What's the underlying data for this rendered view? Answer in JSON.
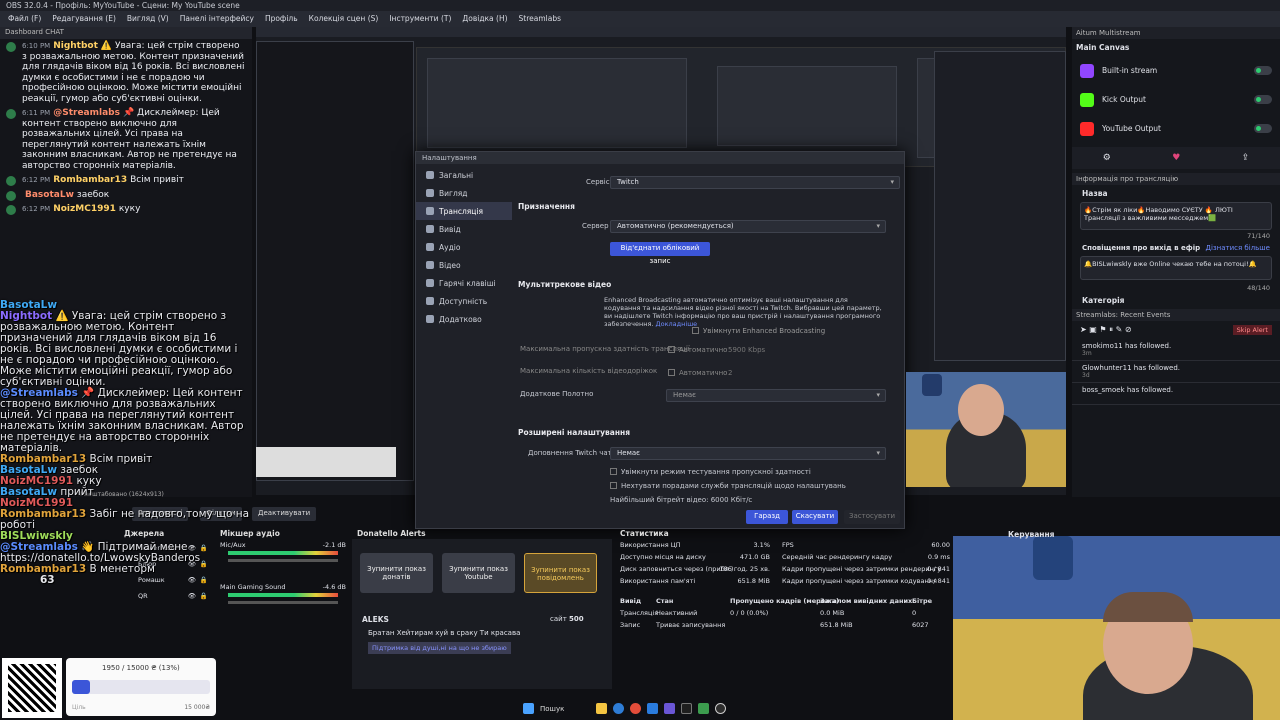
{
  "window": {
    "title": "OBS 32.0.4 - Профіль: MyYouTube - Сцени: My YouTube scene"
  },
  "menu": [
    "Файл (F)",
    "Редагування (E)",
    "Вигляд (V)",
    "Панелі інтерфейсу",
    "Профіль",
    "Колекція сцен (S)",
    "Інструменти (T)",
    "Довідка (H)",
    "Streamlabs"
  ],
  "chat": {
    "header": "Dashboard CHAT",
    "messages": [
      {
        "time": "6:10 PM",
        "user": "Nightbot",
        "text": "⚠️ Увага: цей стрім створено з розважальною метою. Контент призначений для глядачів віком від 16 років. Всі висловлені думки є особистими і не є порадою чи професійною оцінкою. Може містити емоційні реакції, гумор або суб'єктивні оцінки."
      },
      {
        "time": "6:11 PM",
        "user": "@Streamlabs",
        "text": "📌 Дисклеймер: Цей контент створено виключно для розважальних цілей. Усі права на переглянутий контент належать їхнім законним власникам. Автор не претендує на авторство сторонніх матеріалів."
      },
      {
        "time": "6:12 PM",
        "user": "Rombambar13",
        "text": "Всім привіт"
      },
      {
        "time": "",
        "user": "BasotaLw",
        "text": "заебок"
      },
      {
        "time": "6:12 PM",
        "user": "NoizMC1991",
        "text": "куку"
      }
    ]
  },
  "overlay_chat": [
    {
      "user": "BasotaLw",
      "text": ""
    },
    {
      "user": "Nightbot",
      "text": "⚠️ Увага: цей стрім створено з розважальною метою. Контент призначений для глядачів віком від 16 років. Всі висловлені думки є особистими і не є порадою чи професійною оцінкою. Може містити емоційні реакції, гумор або суб'єктивні оцінки."
    },
    {
      "user": "@Streamlabs",
      "text": "📌 Дисклеймер: Цей контент створено виключно для розважальних цілей. Усі права на переглянутий контент належать їхнім законним власникам. Автор не претендує на авторство сторонніх матеріалів."
    },
    {
      "user": "Rombambar13",
      "text": "Всім привіт"
    },
    {
      "user": "BasotaLw",
      "text": "заебок"
    },
    {
      "user": "NoizMC1991",
      "text": "куку"
    },
    {
      "user": "BasotaLw",
      "text": "прийт"
    },
    {
      "user": "NoizMC1991",
      "text": ""
    },
    {
      "user": "Rombambar13",
      "text": "Забіг не надовго,тому що на роботі"
    },
    {
      "user": "BISLwiwskly",
      "text": ""
    },
    {
      "user": "@Streamlabs",
      "text": "👋 Підтримай мене - https://donatello.to/LwowskyBanderos"
    },
    {
      "user": "Rombambar13",
      "text": "В менеторм"
    }
  ],
  "overlay_counter": "63",
  "settings": {
    "title": "Налаштування",
    "sidebar": [
      "Загальні",
      "Вигляд",
      "Трансляція",
      "Вивід",
      "Аудіо",
      "Відео",
      "Гарячі клавіші",
      "Доступність",
      "Додатково"
    ],
    "active_index": 2,
    "service_label": "Сервіс",
    "service_value": "Twitch",
    "purpose_section": "Призначення",
    "server_label": "Сервер",
    "server_value": "Автоматично (рекомендується)",
    "disconnect_button": "Від'єднати обліковий запис",
    "multitrack_section": "Мультитрекове відео",
    "multitrack_desc": "Enhanced Broadcasting автоматично оптимізує ваші налаштування для кодування та надсилання відео різної якості на Twitch. Вибравши цей параметр, ви надішлете Twitch інформацію про ваш пристрій і налаштування програмного забезпечення.",
    "multitrack_more": "Докладніше",
    "enable_enhanced": "Увімкнути Enhanced Broadcasting",
    "max_bandwidth_label": "Максимальна пропускна здатність трансляції",
    "max_video_tracks_label": "Максимальна кількість відеодоріжок",
    "auto_label": "Автоматично",
    "bandwidth_value": "5900 Kbps",
    "tracks_value": "2",
    "extra_canvas_label": "Додаткове Полотно",
    "extra_canvas_value": "Немає",
    "advanced_section": "Розширені налаштування",
    "twitch_chat_label": "Доповнення Twitch чату",
    "twitch_chat_value": "Немає",
    "bw_test": "Увімкнути режим тестування пропускної здатності",
    "ignore_service": "Нехтувати порадами служби трансляцій щодо налаштувань",
    "max_bitrate": "Найбільший бітрейт відео: 6000 Кбіт/с",
    "ok": "Гаразд",
    "cancel": "Скасувати",
    "apply": "Застосувати"
  },
  "multistream": {
    "header": "Aitum Multistream",
    "canvas": "Main Canvas",
    "outputs": [
      {
        "name": "Built-in stream",
        "color": "#9146ff"
      },
      {
        "name": "Kick Output",
        "color": "#53fc18"
      },
      {
        "name": "YouTube Output",
        "color": "#ff2a2a"
      }
    ],
    "info_header": "Інформація про трансляцію",
    "title_label": "Назва",
    "title_value": "🔥Стрім як ліки🔥Наводимо СУЄТУ 🔥 ЛЮТІ Трансляції з важливими месседжем🟩",
    "title_counter": "71/140",
    "notify_label": "Сповіщення про вихід в ефір",
    "notify_more": "Дізнатися більше",
    "notify_value": "🔔BISLwiwskly вже Online чекаю тебе на потоці!🔔",
    "notify_counter": "48/140",
    "category_label": "Категорія",
    "events_header": "Streamlabs: Recent Events",
    "skip_alert": "Skip Alert",
    "events": [
      {
        "user": "smokimo11",
        "text": "has followed.",
        "ago": "3m"
      },
      {
        "user": "Glowhunter11",
        "text": "has followed.",
        "ago": "3d"
      },
      {
        "user": "boss_smoek",
        "text": "has followed.",
        "ago": ""
      }
    ]
  },
  "bottom": {
    "props_button": "Властивості",
    "filters_button": "Фільтри",
    "deactivate_button": "Деактивувати",
    "scale_label": "Масштабовано (1624x913)",
    "sources_header": "Джерела",
    "sources": [
      "Viewer Cour",
      "Блюр",
      "Ромашк",
      "QR"
    ],
    "mixer_header": "Мікшер аудіо",
    "mixer_tracks": [
      {
        "name": "Mic/Aux",
        "db": "-2.1 dB"
      },
      {
        "name": "Main Gaming Sound",
        "db": "-4.6 dB"
      }
    ],
    "donatello_header": "Donatello Alerts",
    "alert_buttons": [
      "Зупинити показ донатів",
      "Зупинити показ Youtube",
      "Зупинити показ повідомлень"
    ],
    "donation": {
      "name": "ALEKS",
      "site": "сайт",
      "amount": "500",
      "message": "Братан Хейтирам хуй в сраку Ти красава",
      "goal_note": "Підтримка від душі,ні на що не збираю"
    },
    "goal": {
      "text": "1950 / 15000 ₴ (13%)",
      "progress": 0.13,
      "end": "15 000₴",
      "start": "Ціль"
    },
    "stats_header": "Статистика",
    "stats": [
      {
        "label": "Використання ЦП",
        "value": "3.1%"
      },
      {
        "label": "Доступно місця на диску",
        "value": "471.0 GB"
      },
      {
        "label": "Диск заповниться через (прибл.)",
        "value": "186 год. 25 хв."
      },
      {
        "label": "Використання пам'яті",
        "value": "651.8 MiB"
      }
    ],
    "stats_right": [
      {
        "label": "FPS",
        "value": "60.00"
      },
      {
        "label": "Середній час рендерингу кадру",
        "value": "0.9 ms"
      },
      {
        "label": "Кадри пропущені через затримки рендерингу",
        "value": "0 / 841"
      },
      {
        "label": "Кадри пропущені через затримки кодування",
        "value": "0 / 841"
      }
    ],
    "table_headers": [
      "Вивід",
      "Стан",
      "Пропущено кадрів (мережа)",
      "Загалом вивідних даних",
      "Бітре"
    ],
    "table_rows": [
      [
        "Трансляція",
        "Неактивний",
        "0 / 0 (0.0%)",
        "0.0 MiB",
        "0"
      ],
      [
        "Запис",
        "Триває записування",
        "",
        "651.8 MiB",
        "6027"
      ]
    ],
    "control_header": "Керування"
  },
  "taskbar": {
    "search": "Пошук"
  }
}
